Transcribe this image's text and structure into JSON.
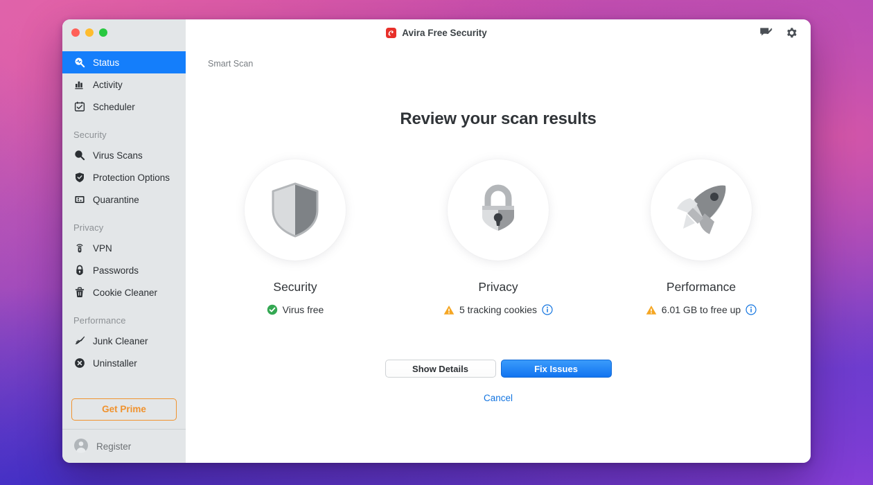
{
  "window": {
    "app_title": "Avira Free Security",
    "logo_name": "avira-logo",
    "traffic_lights": [
      "close",
      "minimize",
      "zoom"
    ],
    "title_actions": [
      {
        "name": "feedback-icon",
        "label": "Feedback"
      },
      {
        "name": "settings-gear-icon",
        "label": "Settings"
      }
    ]
  },
  "sidebar": {
    "items": [
      {
        "label": "Status",
        "icon": "status-magnifier-icon",
        "active": true
      },
      {
        "label": "Activity",
        "icon": "activity-chart-icon",
        "active": false
      },
      {
        "label": "Scheduler",
        "icon": "scheduler-calendar-icon",
        "active": false
      }
    ],
    "groups": [
      {
        "title": "Security",
        "items": [
          {
            "label": "Virus Scans",
            "icon": "virus-scan-magnifier-icon"
          },
          {
            "label": "Protection Options",
            "icon": "shield-check-icon"
          },
          {
            "label": "Quarantine",
            "icon": "quarantine-box-icon"
          }
        ]
      },
      {
        "title": "Privacy",
        "items": [
          {
            "label": "VPN",
            "icon": "vpn-signal-icon"
          },
          {
            "label": "Passwords",
            "icon": "padlock-icon"
          },
          {
            "label": "Cookie Cleaner",
            "icon": "trash-icon"
          }
        ]
      },
      {
        "title": "Performance",
        "items": [
          {
            "label": "Junk Cleaner",
            "icon": "broom-icon"
          },
          {
            "label": "Uninstaller",
            "icon": "circle-x-icon"
          }
        ]
      }
    ],
    "prime_button": "Get Prime",
    "register": {
      "label": "Register",
      "icon": "user-avatar-icon"
    }
  },
  "main": {
    "breadcrumb": "Smart Scan",
    "headline": "Review your scan results",
    "cards": [
      {
        "title": "Security",
        "icon": "shield-icon",
        "status_text": "Virus free",
        "status_type": "ok",
        "status_icon": "green-check-icon",
        "has_info": false
      },
      {
        "title": "Privacy",
        "icon": "padlock-icon",
        "status_text": "5 tracking cookies",
        "status_type": "warning",
        "status_icon": "warning-triangle-icon",
        "has_info": true,
        "info_icon": "info-circle-icon"
      },
      {
        "title": "Performance",
        "icon": "rocket-icon",
        "status_text": "6.01 GB to free up",
        "status_type": "warning",
        "status_icon": "warning-triangle-icon",
        "has_info": true,
        "info_icon": "info-circle-icon"
      }
    ],
    "buttons": {
      "show_details": "Show Details",
      "fix_issues": "Fix Issues",
      "cancel": "Cancel"
    }
  },
  "colors": {
    "accent_blue": "#147efb",
    "primary_button": "#1274f0",
    "prime_orange": "#f0922d",
    "ok_green": "#34a853",
    "warning_orange": "#f5a623",
    "info_blue": "#1274e0",
    "sidebar_bg": "#e3e6e8"
  }
}
